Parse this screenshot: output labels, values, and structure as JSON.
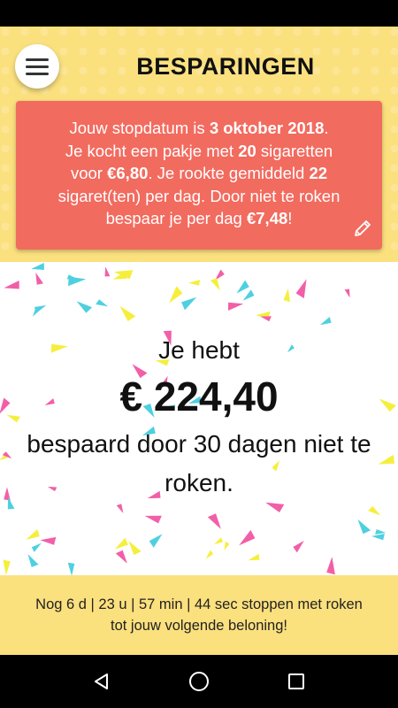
{
  "header": {
    "title": "BESPARINGEN"
  },
  "info": {
    "t1": "Jouw stopdatum is ",
    "stop_date": "3 oktober 2018",
    "t2": ".",
    "t3": "Je kocht een pakje met ",
    "pack_size": "20",
    "t4": " sigaretten",
    "t5": "voor ",
    "pack_price": "€6,80",
    "t6": ". Je rookte gemiddeld ",
    "per_day": "22",
    "t7": "sigaret(ten) per dag. Door niet te roken",
    "t8": "bespaar je per dag ",
    "daily_saving": "€7,48",
    "t9": "!"
  },
  "saving": {
    "intro": "Je hebt",
    "amount": "€ 224,40",
    "description": "bespaard door 30 dagen niet te roken."
  },
  "footer": {
    "countdown": "Nog 6 d | 23 u | 57 min | 44 sec stoppen met roken tot jouw volgende beloning!"
  },
  "icons": {
    "menu": "hamburger-menu-icon",
    "edit": "pencil-icon",
    "back": "back-triangle-icon",
    "home": "home-circle-icon",
    "recents": "recents-square-icon"
  },
  "colors": {
    "header_bg": "#fbe07e",
    "card_bg": "#f26b5f",
    "confetti": [
      "#4ed0e0",
      "#f25fa8",
      "#f5ef3c"
    ]
  }
}
